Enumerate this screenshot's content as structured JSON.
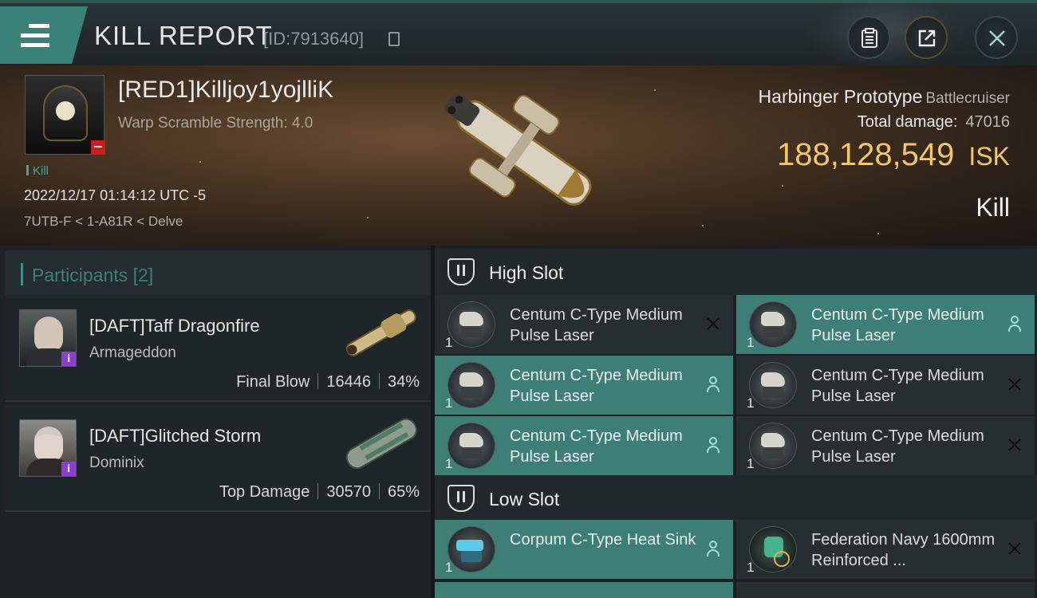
{
  "header": {
    "title": "KILL REPORT",
    "report_id": "[ID:7913640]"
  },
  "victim": {
    "name": "[RED1]Killjoy1yojlliK",
    "warp_scramble": "Warp Scramble Strength: 4.0",
    "kill_tag": "Kill",
    "datetime": "2022/12/17 01:14:12 UTC -5",
    "location": "7UTB-F < 1-A81R < Delve",
    "ship_name": "Harbinger Prototype",
    "ship_class": "Battlecruiser",
    "total_damage_label": "Total damage:",
    "total_damage_value": "47016",
    "isk_value": "188,128,549",
    "isk_unit": "ISK",
    "result": "Kill"
  },
  "participants": {
    "title": "Participants",
    "count": "[2]",
    "items": [
      {
        "name": "[DAFT]Taff Dragonfire",
        "ship": "Armageddon",
        "role": "Final Blow",
        "damage": "16446",
        "percent": "34%"
      },
      {
        "name": "[DAFT]Glitched Storm",
        "ship": "Dominix",
        "role": "Top Damage",
        "damage": "30570",
        "percent": "65%"
      }
    ]
  },
  "slots": {
    "high": {
      "label": "High Slot",
      "modules": [
        {
          "name": "Centum C-Type Medium Pulse Laser",
          "qty": "1",
          "state": "destroyed",
          "action": "x-icon"
        },
        {
          "name": "Centum C-Type Medium Pulse Laser",
          "qty": "1",
          "state": "dropped",
          "action": "user-icon"
        },
        {
          "name": "Centum C-Type Medium Pulse Laser",
          "qty": "1",
          "state": "dropped",
          "action": "user-icon"
        },
        {
          "name": "Centum C-Type Medium Pulse Laser",
          "qty": "1",
          "state": "destroyed",
          "action": "x-icon"
        },
        {
          "name": "Centum C-Type Medium Pulse Laser",
          "qty": "1",
          "state": "dropped",
          "action": "user-icon"
        },
        {
          "name": "Centum C-Type Medium Pulse Laser",
          "qty": "1",
          "state": "destroyed",
          "action": "x-icon"
        }
      ]
    },
    "low": {
      "label": "Low Slot",
      "modules": [
        {
          "name": "Corpum C-Type Heat Sink",
          "qty": "1",
          "state": "dropped",
          "action": "user-icon"
        },
        {
          "name": "Federation Navy 1600mm Reinforced ...",
          "qty": "1",
          "state": "destroyed",
          "action": "x-icon"
        }
      ]
    }
  },
  "colors": {
    "accent": "#3d7f77",
    "isk": "#f4c56b",
    "badge_red": "#c81e1e",
    "badge_purple": "#8b3fd1"
  }
}
